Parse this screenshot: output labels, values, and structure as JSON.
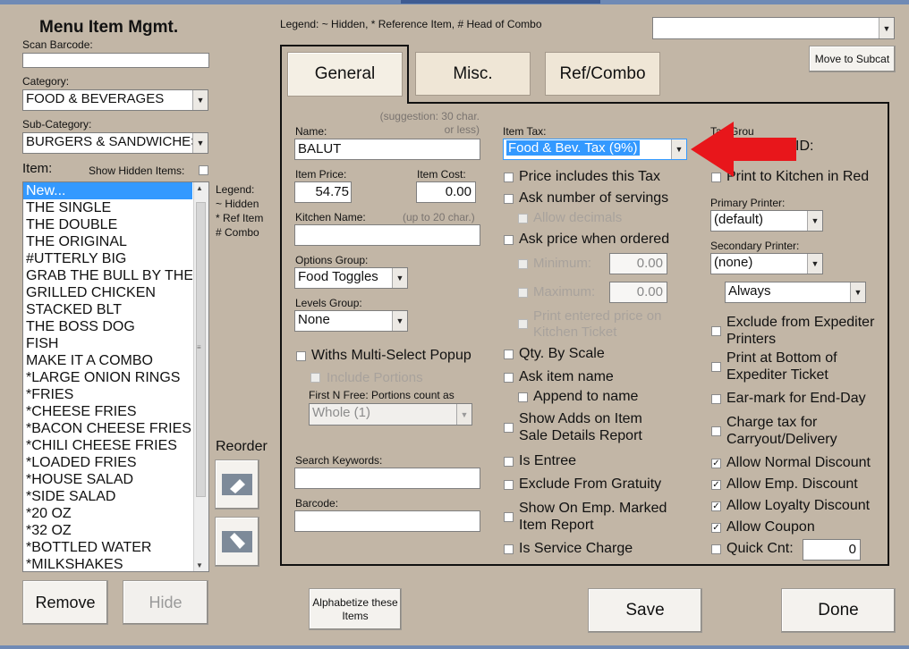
{
  "window": {
    "title": "Menu Item Mgmt."
  },
  "top_legend": "Legend: ~ Hidden, * Reference Item, # Head of Combo",
  "top_combo_value": "",
  "move_to_subcat_label": "Move to Subcat",
  "left": {
    "scan_barcode_label": "Scan Barcode:",
    "scan_barcode_value": "",
    "category_label": "Category:",
    "category_value": "FOOD & BEVERAGES",
    "subcategory_label": "Sub-Category:",
    "subcategory_value": "BURGERS & SANDWICHES",
    "item_label": "Item:",
    "show_hidden_label": "Show Hidden Items:",
    "items": [
      "New...",
      "THE SINGLE",
      "THE DOUBLE",
      "THE ORIGINAL",
      "#UTTERLY BIG",
      "GRAB THE BULL BY THE HORNS",
      "GRILLED CHICKEN",
      "STACKED BLT",
      "THE BOSS DOG",
      "FISH",
      "MAKE IT A COMBO",
      "*LARGE ONION RINGS",
      "*FRIES",
      "*CHEESE FRIES",
      "*BACON CHEESE FRIES",
      "*CHILI CHEESE FRIES",
      "*LOADED FRIES",
      "*HOUSE SALAD",
      "*SIDE SALAD",
      "*20 OZ",
      "*32 OZ",
      "*BOTTLED WATER",
      "*MILKSHAKES"
    ],
    "legend_lines": [
      "Legend:",
      "~ Hidden",
      "* Ref Item",
      "# Combo"
    ],
    "reorder_label": "Reorder",
    "remove_label": "Remove",
    "hide_label": "Hide"
  },
  "tabs": [
    "General",
    "Misc.",
    "Ref/Combo"
  ],
  "form": {
    "name_label": "Name:",
    "name_suggestion": "(suggestion: 30 char. or less)",
    "name_value": "BALUT",
    "item_price_label": "Item Price:",
    "item_price_value": "54.75",
    "item_cost_label": "Item Cost:",
    "item_cost_value": "0.00",
    "kitchen_name_label": "Kitchen Name:",
    "kitchen_name_hint": "(up to 20 char.)",
    "kitchen_name_value": "",
    "options_group_label": "Options Group:",
    "options_group_value": "Food Toggles",
    "levels_group_label": "Levels Group:",
    "levels_group_value": "None",
    "withs_multi_label": "Withs Multi-Select Popup",
    "include_portions_label": "Include Portions",
    "first_n_free_label": "First N Free: Portions count as",
    "first_n_free_value": "Whole (1)",
    "search_keywords_label": "Search Keywords:",
    "search_keywords_value": "",
    "barcode_label": "Barcode:",
    "barcode_value": ""
  },
  "middle": {
    "item_tax_label": "Item Tax:",
    "item_tax_value": "Food & Bev. Tax (9%)",
    "price_includes_tax": "Price includes this Tax",
    "ask_servings": "Ask number of servings",
    "allow_decimals": "Allow decimals",
    "ask_price": "Ask price when ordered",
    "minimum_label": "Minimum:",
    "minimum_value": "0.00",
    "maximum_label": "Maximum:",
    "maximum_value": "0.00",
    "print_entered_price": "Print entered price on Kitchen Ticket",
    "qty_by_scale": "Qty. By Scale",
    "ask_item_name": "Ask item name",
    "append_to_name": "Append to name",
    "show_adds": "Show Adds on Item Sale Details Report",
    "is_entree": "Is Entree",
    "exclude_gratuity": "Exclude From Gratuity",
    "show_on_emp": "Show On Emp. Marked Item Report",
    "is_service_charge": "Is Service Charge"
  },
  "right": {
    "tax_group_label": "Tax Grou",
    "id_label": "ID:",
    "print_kitchen_red": "Print to Kitchen in Red",
    "primary_printer_label": "Primary Printer:",
    "primary_printer_value": "(default)",
    "secondary_printer_label": "Secondary Printer:",
    "secondary_printer_value": "(none)",
    "always_value": "Always",
    "exclude_expediter": "Exclude from Expediter Printers",
    "print_bottom_expediter": "Print at Bottom of Expediter Ticket",
    "ear_mark": "Ear-mark for End-Day",
    "charge_tax": "Charge tax for Carryout/Delivery",
    "allow_normal_discount": "Allow Normal Discount",
    "allow_emp_discount": "Allow Emp. Discount",
    "allow_loyalty_discount": "Allow Loyalty Discount",
    "allow_coupon": "Allow Coupon",
    "quick_cnt_label": "Quick Cnt:",
    "quick_cnt_value": "0"
  },
  "bottom": {
    "alphabetize_label": "Alphabetize these Items",
    "save_label": "Save",
    "done_label": "Done"
  },
  "colors": {
    "background": "#c2b6a6",
    "selection": "#3399ff",
    "annotation_arrow": "#e8161b"
  }
}
